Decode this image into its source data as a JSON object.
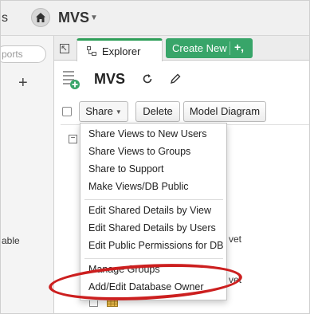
{
  "topbar": {
    "clip_text": "s",
    "workspace": "MVS"
  },
  "sidebar": {
    "search_placeholder": "ports",
    "clip_label": "able"
  },
  "tabs": {
    "explorer_label": "Explorer",
    "create_new_label": "Create New"
  },
  "database": {
    "title": "MVS"
  },
  "toolbar": {
    "share_label": "Share",
    "delete_label": "Delete",
    "model_diagram_label": "Model Diagram"
  },
  "background": {
    "row1_text": "vet",
    "row2_text": "vet"
  },
  "share_menu": {
    "items": [
      "Share Views to New Users",
      "Share Views to Groups",
      "Share to Support",
      "Make Views/DB Public",
      "Edit Shared Details by View",
      "Edit Shared Details by Users",
      "Edit Public Permissions for DB",
      "Manage Groups",
      "Add/Edit Database Owner"
    ]
  },
  "colors": {
    "accent_green": "#38a569",
    "highlight_red": "#cc1f1f"
  }
}
